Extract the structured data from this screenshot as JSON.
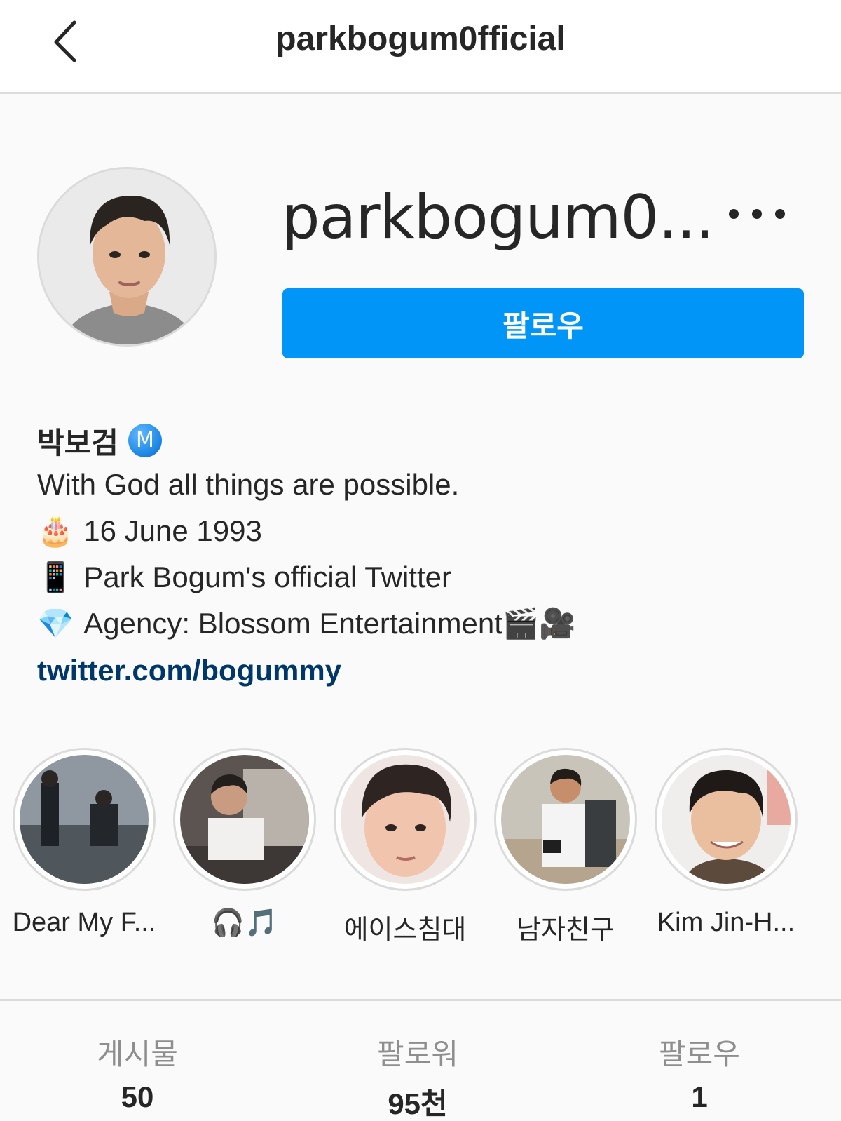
{
  "header": {
    "title": "parkbogum0fficial",
    "back_icon": "chevron-left-icon"
  },
  "profile": {
    "username_display": "parkbogum0...",
    "more_icon": "more-dots-icon",
    "follow_label": "팔로우",
    "follow_color": "#0095f6"
  },
  "bio": {
    "name": "박보검",
    "verified_badge": "M",
    "lines": [
      {
        "emoji": "",
        "text": "With God all things are possible."
      },
      {
        "emoji": "🎂",
        "text": "16 June 1993"
      },
      {
        "emoji": "📱",
        "text": "Park Bogum's official Twitter"
      },
      {
        "emoji": "💎",
        "text": "Agency: Blossom Entertainment🎬🎥"
      }
    ],
    "link": "twitter.com/bogummy",
    "link_color": "#00376b"
  },
  "highlights": [
    {
      "label": "Dear My F..."
    },
    {
      "label": "🎧🎵"
    },
    {
      "label": "에이스침대"
    },
    {
      "label": "남자친구"
    },
    {
      "label": "Kim Jin-H..."
    }
  ],
  "stats": {
    "posts": {
      "label": "게시물",
      "value": "50"
    },
    "followers": {
      "label": "팔로워",
      "value": "95천"
    },
    "following": {
      "label": "팔로우",
      "value": "1"
    }
  }
}
